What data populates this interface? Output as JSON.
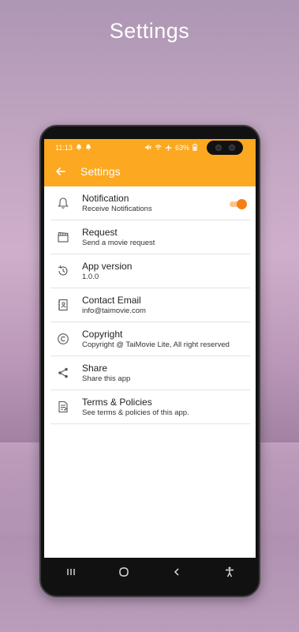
{
  "hero": {
    "title": "Settings"
  },
  "status_bar": {
    "time": "11:13",
    "battery": "63%",
    "left_icons": [
      "alarm-icon",
      "notification-bell-icon"
    ],
    "right_icons": [
      "mute-icon",
      "wifi-icon",
      "airplane-icon",
      "battery-icon"
    ]
  },
  "app_bar": {
    "title": "Settings",
    "back_icon": "arrow-left-icon",
    "color": "#fca820"
  },
  "settings": {
    "items": [
      {
        "icon": "bell-icon",
        "title": "Notification",
        "subtitle": "Receive Notifications",
        "toggle_on": true
      },
      {
        "icon": "clapperboard-icon",
        "title": "Request",
        "subtitle": "Send a movie request"
      },
      {
        "icon": "history-icon",
        "title": "App version",
        "subtitle": "1.0.0"
      },
      {
        "icon": "contact-book-icon",
        "title": "Contact Email",
        "subtitle": "info@taimovie.com"
      },
      {
        "icon": "copyright-icon",
        "title": "Copyright",
        "subtitle": "Copyright @ TaiMovie Lite, All right reserved"
      },
      {
        "icon": "share-icon",
        "title": "Share",
        "subtitle": "Share this app"
      },
      {
        "icon": "document-icon",
        "title": "Terms & Policies",
        "subtitle": "See terms & policies of this app."
      }
    ]
  },
  "nav_bar": {
    "items": [
      "recents-icon",
      "home-icon",
      "back-icon",
      "accessibility-icon"
    ]
  },
  "colors": {
    "accent": "#fca820",
    "toggle_thumb": "#f77f12"
  }
}
